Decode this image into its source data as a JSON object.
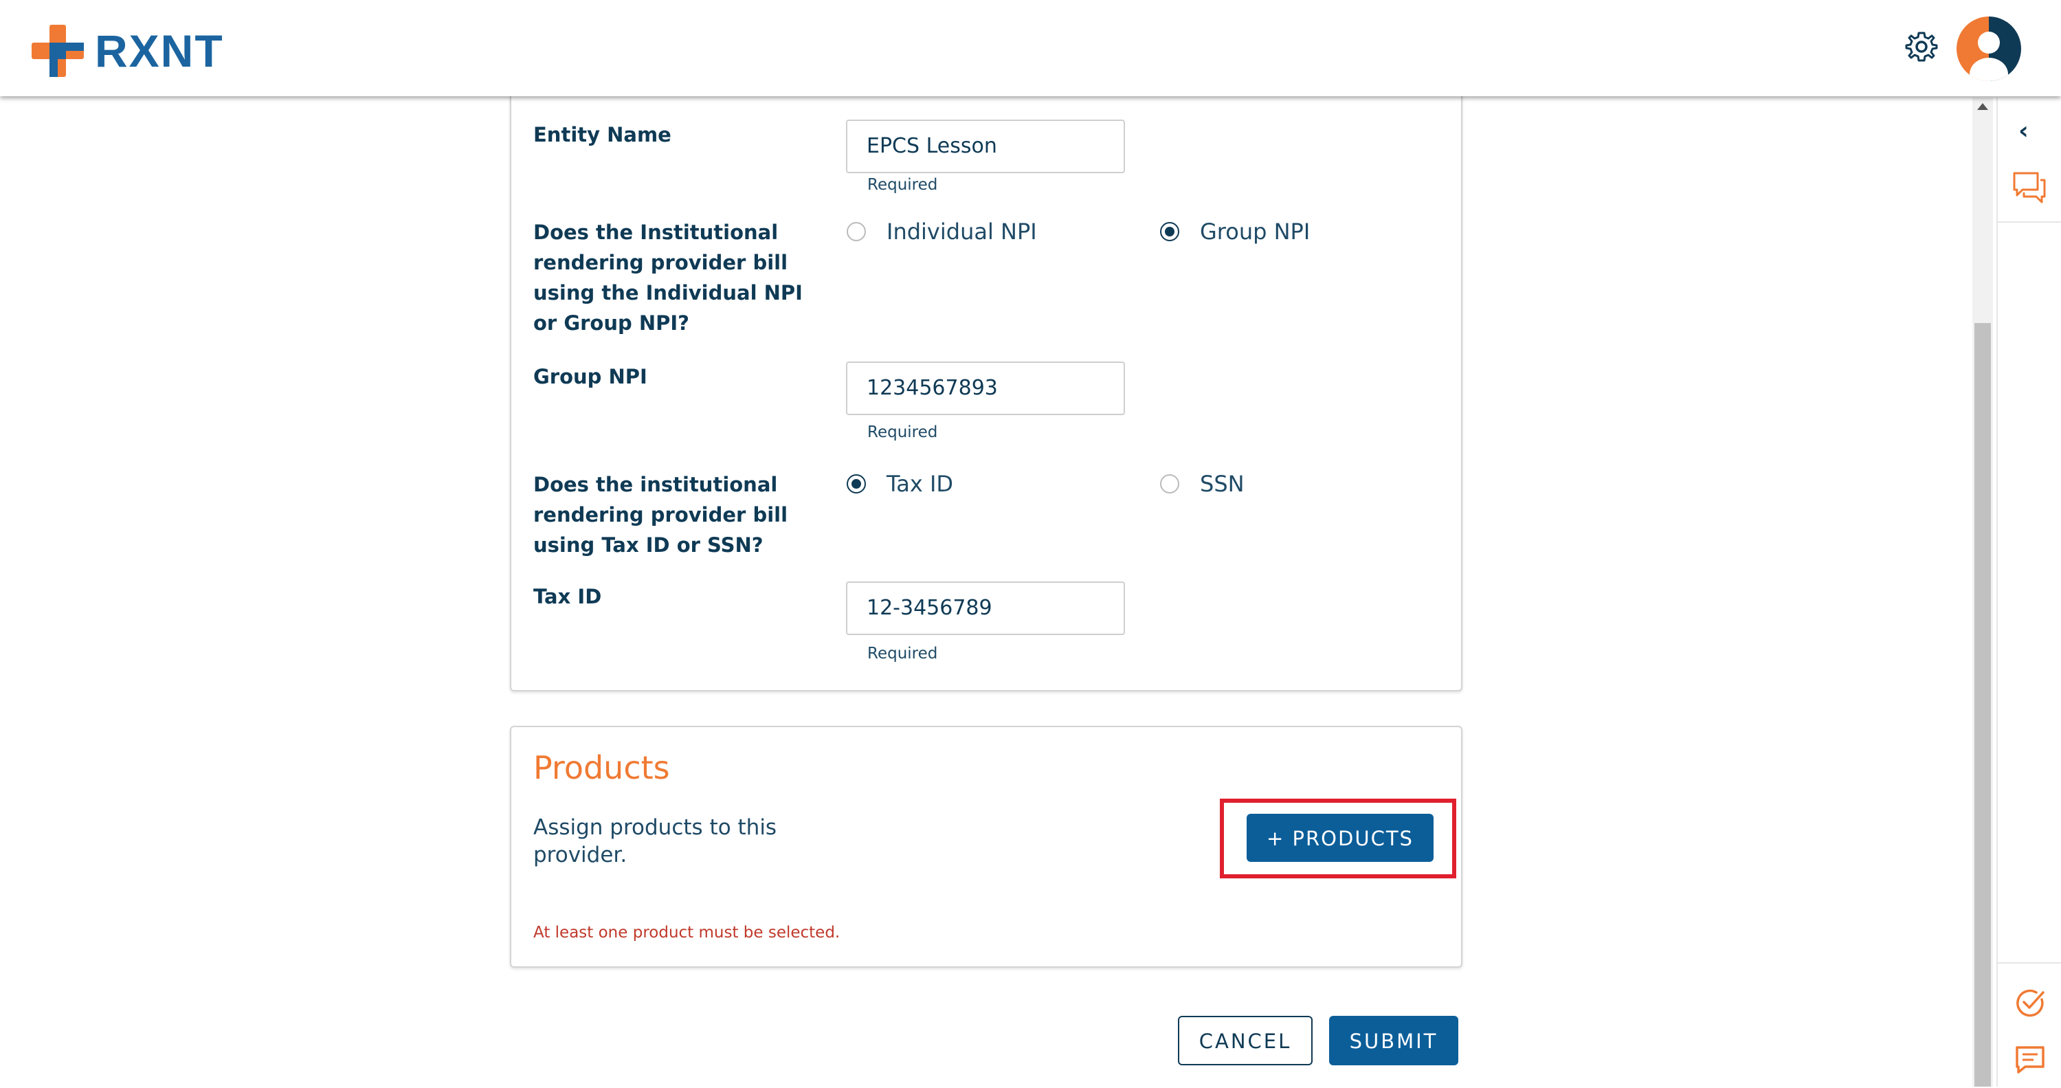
{
  "header": {
    "brand": "RXNT",
    "settings_icon": "gear-icon",
    "avatar_icon": "user-avatar-icon"
  },
  "form": {
    "entity_name": {
      "label": "Entity Name",
      "value": "EPCS Lesson",
      "helper": "Required"
    },
    "npi_question": {
      "label": "Does the Institutional rendering provider bill using the Individual NPI or Group NPI?",
      "options": [
        "Individual NPI",
        "Group NPI"
      ],
      "selected": "Group NPI"
    },
    "group_npi": {
      "label": "Group NPI",
      "value": "1234567893",
      "helper": "Required"
    },
    "tax_question": {
      "label": "Does the institutional rendering provider bill using Tax ID or SSN?",
      "options": [
        "Tax ID",
        "SSN"
      ],
      "selected": "Tax ID"
    },
    "tax_id": {
      "label": "Tax ID",
      "value": "12-3456789",
      "helper": "Required"
    }
  },
  "products": {
    "title": "Products",
    "description": "Assign products to this provider.",
    "button_label": "+ PRODUCTS",
    "error": "At least one product must be selected."
  },
  "actions": {
    "cancel_label": "CANCEL",
    "submit_label": "SUBMIT"
  },
  "rail": {
    "collapse_icon": "chevron-left-icon",
    "chat_icon": "chat-bubbles-icon",
    "tasks_icon": "check-circle-icon",
    "messages_icon": "message-icon"
  },
  "colors": {
    "brand_blue": "#0c5e99",
    "brand_orange": "#f07a33",
    "text_dark": "#0f3a55",
    "error_red": "#c0392b",
    "highlight_red": "#e0202e"
  }
}
